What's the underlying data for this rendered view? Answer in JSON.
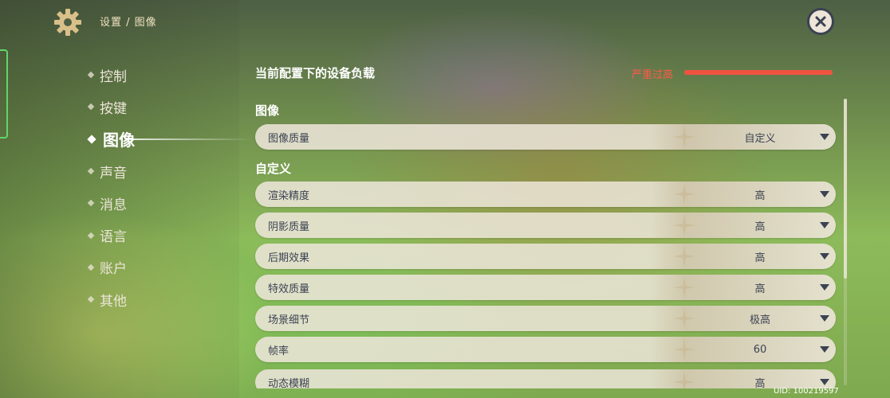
{
  "header": {
    "breadcrumb": "设置 / 图像",
    "icon": "gear-icon",
    "close_icon": "close-icon"
  },
  "nav": {
    "items": [
      {
        "label": "控制",
        "active": false
      },
      {
        "label": "按键",
        "active": false
      },
      {
        "label": "图像",
        "active": true
      },
      {
        "label": "声音",
        "active": false
      },
      {
        "label": "消息",
        "active": false
      },
      {
        "label": "语言",
        "active": false
      },
      {
        "label": "账户",
        "active": false
      },
      {
        "label": "其他",
        "active": false
      }
    ]
  },
  "load": {
    "label": "当前配置下的设备负载",
    "status": "严重过高",
    "level_percent": 100,
    "color": "#f0533f"
  },
  "sections": {
    "image_title": "图像",
    "custom_title": "自定义"
  },
  "settings": {
    "image_quality": {
      "label": "图像质量",
      "value": "自定义"
    },
    "rows": [
      {
        "label": "渲染精度",
        "value": "高"
      },
      {
        "label": "阴影质量",
        "value": "高"
      },
      {
        "label": "后期效果",
        "value": "高"
      },
      {
        "label": "特效质量",
        "value": "高"
      },
      {
        "label": "场景细节",
        "value": "极高"
      },
      {
        "label": "帧率",
        "value": "60"
      },
      {
        "label": "动态模糊",
        "value": "高"
      }
    ]
  },
  "footer": {
    "uid": "UID: 100219597"
  },
  "colors": {
    "row_bg": "#ece5d8",
    "row_text": "#3b4252",
    "warning": "#ff5a49"
  }
}
